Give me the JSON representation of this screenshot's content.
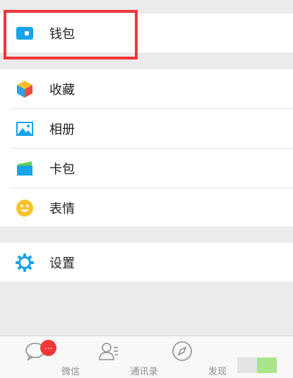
{
  "menu": {
    "wallet": {
      "label": "钱包",
      "icon": "wallet-icon"
    },
    "favorites": {
      "label": "收藏",
      "icon": "favorites-cube-icon"
    },
    "album": {
      "label": "相册",
      "icon": "photo-album-icon"
    },
    "cards": {
      "label": "卡包",
      "icon": "card-package-icon"
    },
    "stickers": {
      "label": "表情",
      "icon": "smiley-face-icon"
    },
    "settings": {
      "label": "设置",
      "icon": "gear-icon"
    }
  },
  "tabbar": {
    "tabs": [
      {
        "label": "微信",
        "icon": "chat-bubble-icon"
      },
      {
        "label": "通讯录",
        "icon": "contacts-icon"
      },
      {
        "label": "发现",
        "icon": "compass-icon"
      }
    ],
    "chat_badge": "…"
  },
  "colors": {
    "highlight": "#f0353a",
    "accent_blue": "#1aa3e8",
    "badge": "#f23838"
  }
}
